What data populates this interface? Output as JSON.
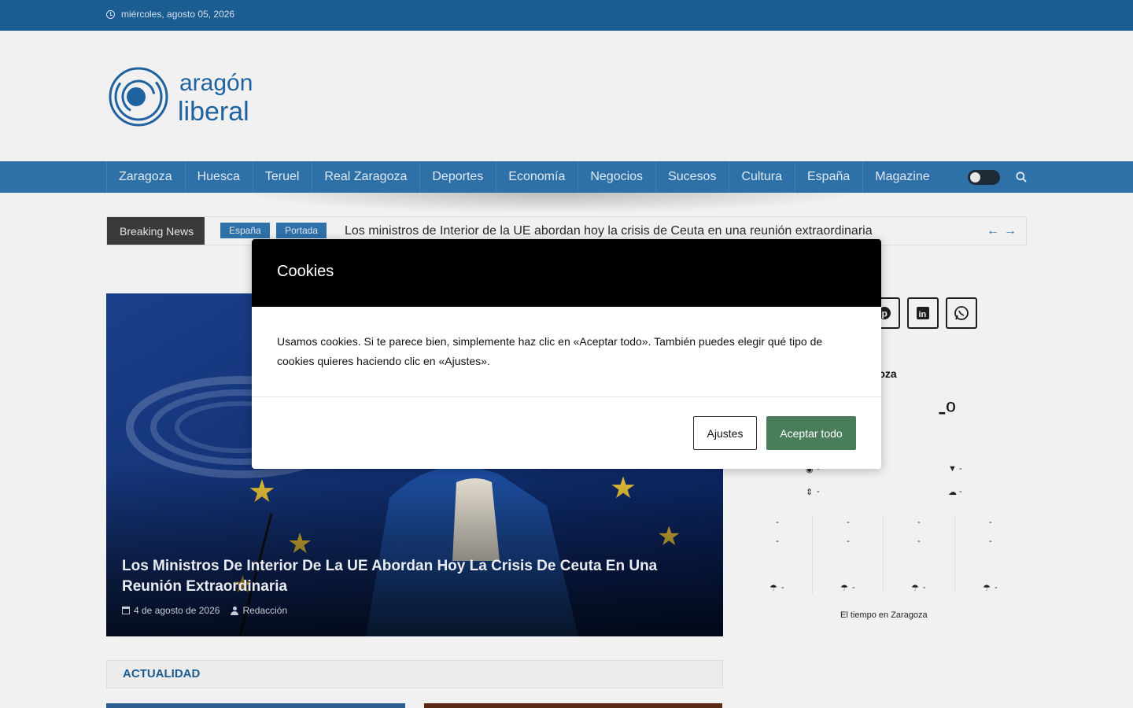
{
  "topbar": {
    "date": "miércoles, agosto 05, 2026"
  },
  "logo": {
    "line1": "aragón",
    "line2": "liberal"
  },
  "nav": {
    "items": [
      "Zaragoza",
      "Huesca",
      "Teruel",
      "Real Zaragoza",
      "Deportes",
      "Economía",
      "Negocios",
      "Sucesos",
      "Cultura",
      "España",
      "Magazine"
    ]
  },
  "breaking": {
    "label": "Breaking News",
    "tags": [
      "España",
      "Portada"
    ],
    "headline": "Los ministros de Interior de la UE abordan hoy la crisis de Ceuta en una reunión extraordinaria"
  },
  "hero": {
    "title": "Los Ministros De Interior De La UE Abordan Hoy La Crisis De Ceuta En Una Reunión Extraordinaria",
    "date": "4 de agosto de 2026",
    "author": "Redacción"
  },
  "section": {
    "title": "ACTUALIDAD"
  },
  "weather": {
    "city": "agoza",
    "temp": "-º",
    "dash": "-",
    "footer": "El tiempo en Zaragoza"
  },
  "cookie_modal": {
    "title": "Cookies",
    "body": "Usamos cookies. Si te parece bien, simplemente haz clic en «Aceptar todo». También puedes elegir qué tipo de cookies quieres haciendo clic en «Ajustes».",
    "settings_label": "Ajustes",
    "accept_label": "Aceptar todo"
  },
  "colors": {
    "topbar": "#1b5c91",
    "nav": "#2e70a8",
    "accept": "#4a7d5a"
  }
}
